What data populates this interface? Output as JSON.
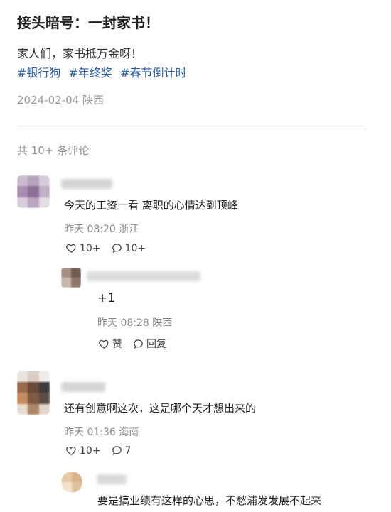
{
  "post": {
    "title": "接头暗号：一封家书！",
    "body": "家人们，家书抵万金呀！",
    "tags": [
      "#银行狗",
      "#年终奖",
      "#春节倒计时"
    ],
    "meta": "2024-02-04 陕西"
  },
  "comments_count": "共 10+ 条评论",
  "comments": [
    {
      "text": "今天的工资一看 离职的心情达到顶峰",
      "meta": "昨天 08:20 浙江",
      "likes": "10+",
      "replies": "10+",
      "reply": {
        "text": "+1",
        "meta": "昨天 08:28 陕西",
        "like_label": "赞",
        "reply_label": "回复"
      }
    },
    {
      "text": "还有创意啊这次，这是哪个天才想出来的",
      "meta": "昨天 01:36 海南",
      "likes": "10+",
      "replies": "7",
      "reply": {
        "text": "要是搞业绩有这样的心思，不愁浦发发展不起来"
      }
    }
  ],
  "icons": {
    "like": "heart-outline-icon",
    "comment": "speech-bubble-icon"
  },
  "colors": {
    "tag": "#2d5ea8",
    "meta": "#8a8a8a"
  }
}
